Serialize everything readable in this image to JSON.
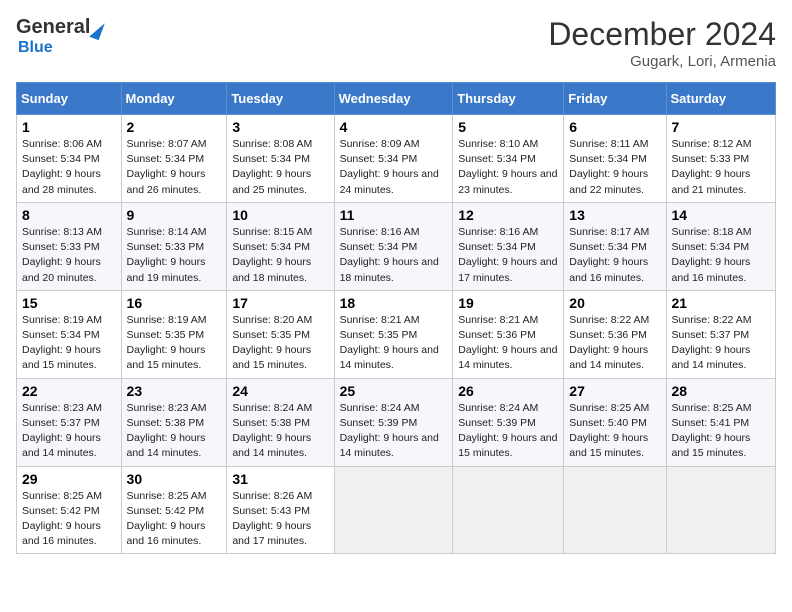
{
  "header": {
    "logo_general": "General",
    "logo_blue": "Blue",
    "month_title": "December 2024",
    "location": "Gugark, Lori, Armenia"
  },
  "weekdays": [
    "Sunday",
    "Monday",
    "Tuesday",
    "Wednesday",
    "Thursday",
    "Friday",
    "Saturday"
  ],
  "weeks": [
    [
      {
        "day": "1",
        "sunrise": "Sunrise: 8:06 AM",
        "sunset": "Sunset: 5:34 PM",
        "daylight": "Daylight: 9 hours and 28 minutes."
      },
      {
        "day": "2",
        "sunrise": "Sunrise: 8:07 AM",
        "sunset": "Sunset: 5:34 PM",
        "daylight": "Daylight: 9 hours and 26 minutes."
      },
      {
        "day": "3",
        "sunrise": "Sunrise: 8:08 AM",
        "sunset": "Sunset: 5:34 PM",
        "daylight": "Daylight: 9 hours and 25 minutes."
      },
      {
        "day": "4",
        "sunrise": "Sunrise: 8:09 AM",
        "sunset": "Sunset: 5:34 PM",
        "daylight": "Daylight: 9 hours and 24 minutes."
      },
      {
        "day": "5",
        "sunrise": "Sunrise: 8:10 AM",
        "sunset": "Sunset: 5:34 PM",
        "daylight": "Daylight: 9 hours and 23 minutes."
      },
      {
        "day": "6",
        "sunrise": "Sunrise: 8:11 AM",
        "sunset": "Sunset: 5:34 PM",
        "daylight": "Daylight: 9 hours and 22 minutes."
      },
      {
        "day": "7",
        "sunrise": "Sunrise: 8:12 AM",
        "sunset": "Sunset: 5:33 PM",
        "daylight": "Daylight: 9 hours and 21 minutes."
      }
    ],
    [
      {
        "day": "8",
        "sunrise": "Sunrise: 8:13 AM",
        "sunset": "Sunset: 5:33 PM",
        "daylight": "Daylight: 9 hours and 20 minutes."
      },
      {
        "day": "9",
        "sunrise": "Sunrise: 8:14 AM",
        "sunset": "Sunset: 5:33 PM",
        "daylight": "Daylight: 9 hours and 19 minutes."
      },
      {
        "day": "10",
        "sunrise": "Sunrise: 8:15 AM",
        "sunset": "Sunset: 5:34 PM",
        "daylight": "Daylight: 9 hours and 18 minutes."
      },
      {
        "day": "11",
        "sunrise": "Sunrise: 8:16 AM",
        "sunset": "Sunset: 5:34 PM",
        "daylight": "Daylight: 9 hours and 18 minutes."
      },
      {
        "day": "12",
        "sunrise": "Sunrise: 8:16 AM",
        "sunset": "Sunset: 5:34 PM",
        "daylight": "Daylight: 9 hours and 17 minutes."
      },
      {
        "day": "13",
        "sunrise": "Sunrise: 8:17 AM",
        "sunset": "Sunset: 5:34 PM",
        "daylight": "Daylight: 9 hours and 16 minutes."
      },
      {
        "day": "14",
        "sunrise": "Sunrise: 8:18 AM",
        "sunset": "Sunset: 5:34 PM",
        "daylight": "Daylight: 9 hours and 16 minutes."
      }
    ],
    [
      {
        "day": "15",
        "sunrise": "Sunrise: 8:19 AM",
        "sunset": "Sunset: 5:34 PM",
        "daylight": "Daylight: 9 hours and 15 minutes."
      },
      {
        "day": "16",
        "sunrise": "Sunrise: 8:19 AM",
        "sunset": "Sunset: 5:35 PM",
        "daylight": "Daylight: 9 hours and 15 minutes."
      },
      {
        "day": "17",
        "sunrise": "Sunrise: 8:20 AM",
        "sunset": "Sunset: 5:35 PM",
        "daylight": "Daylight: 9 hours and 15 minutes."
      },
      {
        "day": "18",
        "sunrise": "Sunrise: 8:21 AM",
        "sunset": "Sunset: 5:35 PM",
        "daylight": "Daylight: 9 hours and 14 minutes."
      },
      {
        "day": "19",
        "sunrise": "Sunrise: 8:21 AM",
        "sunset": "Sunset: 5:36 PM",
        "daylight": "Daylight: 9 hours and 14 minutes."
      },
      {
        "day": "20",
        "sunrise": "Sunrise: 8:22 AM",
        "sunset": "Sunset: 5:36 PM",
        "daylight": "Daylight: 9 hours and 14 minutes."
      },
      {
        "day": "21",
        "sunrise": "Sunrise: 8:22 AM",
        "sunset": "Sunset: 5:37 PM",
        "daylight": "Daylight: 9 hours and 14 minutes."
      }
    ],
    [
      {
        "day": "22",
        "sunrise": "Sunrise: 8:23 AM",
        "sunset": "Sunset: 5:37 PM",
        "daylight": "Daylight: 9 hours and 14 minutes."
      },
      {
        "day": "23",
        "sunrise": "Sunrise: 8:23 AM",
        "sunset": "Sunset: 5:38 PM",
        "daylight": "Daylight: 9 hours and 14 minutes."
      },
      {
        "day": "24",
        "sunrise": "Sunrise: 8:24 AM",
        "sunset": "Sunset: 5:38 PM",
        "daylight": "Daylight: 9 hours and 14 minutes."
      },
      {
        "day": "25",
        "sunrise": "Sunrise: 8:24 AM",
        "sunset": "Sunset: 5:39 PM",
        "daylight": "Daylight: 9 hours and 14 minutes."
      },
      {
        "day": "26",
        "sunrise": "Sunrise: 8:24 AM",
        "sunset": "Sunset: 5:39 PM",
        "daylight": "Daylight: 9 hours and 15 minutes."
      },
      {
        "day": "27",
        "sunrise": "Sunrise: 8:25 AM",
        "sunset": "Sunset: 5:40 PM",
        "daylight": "Daylight: 9 hours and 15 minutes."
      },
      {
        "day": "28",
        "sunrise": "Sunrise: 8:25 AM",
        "sunset": "Sunset: 5:41 PM",
        "daylight": "Daylight: 9 hours and 15 minutes."
      }
    ],
    [
      {
        "day": "29",
        "sunrise": "Sunrise: 8:25 AM",
        "sunset": "Sunset: 5:42 PM",
        "daylight": "Daylight: 9 hours and 16 minutes."
      },
      {
        "day": "30",
        "sunrise": "Sunrise: 8:25 AM",
        "sunset": "Sunset: 5:42 PM",
        "daylight": "Daylight: 9 hours and 16 minutes."
      },
      {
        "day": "31",
        "sunrise": "Sunrise: 8:26 AM",
        "sunset": "Sunset: 5:43 PM",
        "daylight": "Daylight: 9 hours and 17 minutes."
      },
      null,
      null,
      null,
      null
    ]
  ]
}
